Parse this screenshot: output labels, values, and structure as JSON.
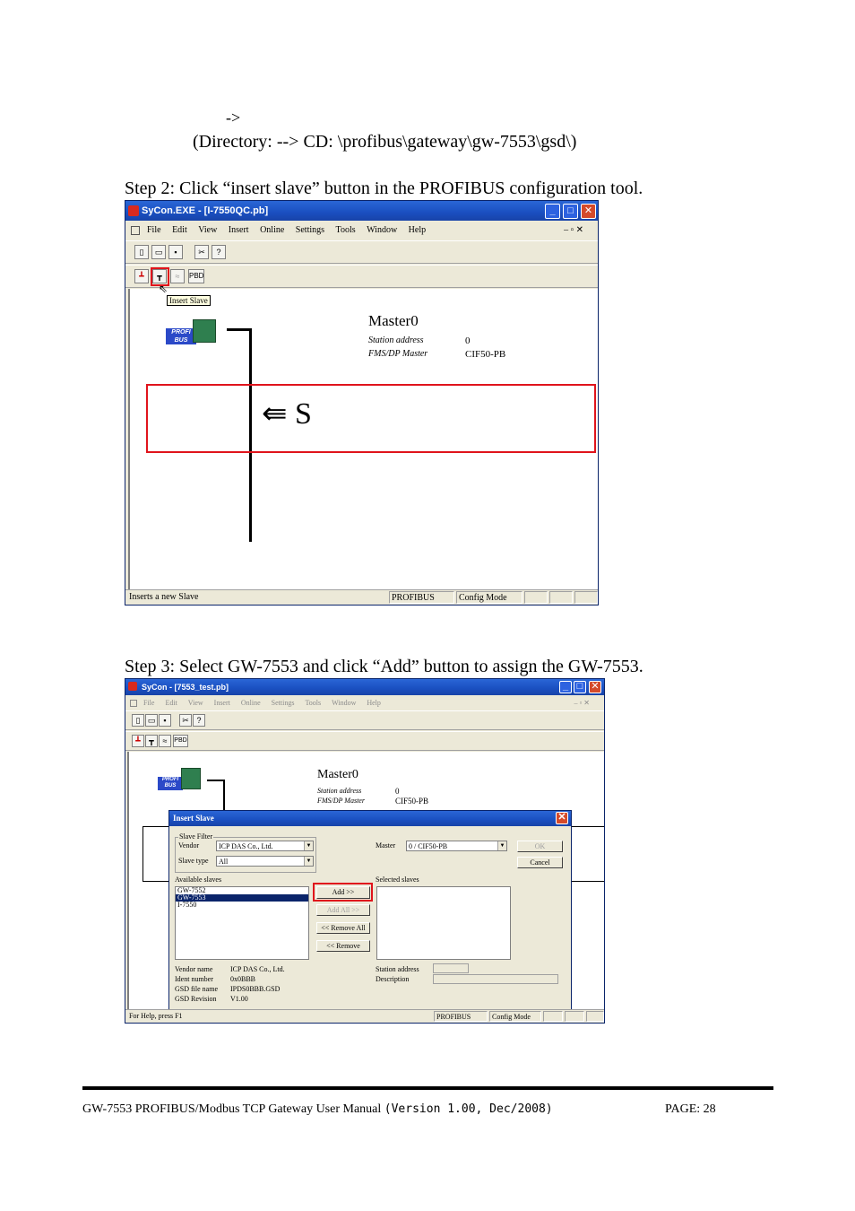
{
  "page": {
    "arrow_line": "->",
    "directory_line": "(Directory: --> CD: \\profibus\\gateway\\gw-7553\\gsd\\)",
    "step2": "Step 2:  Click “insert slave” button in the PROFIBUS configuration tool.",
    "step3": "Step 3:  Select GW-7553 and click “Add” button to assign the GW-7553.",
    "footer_manual": "GW-7553 PROFIBUS/Modbus TCP Gateway User Manual",
    "footer_version": "(Version 1.00, Dec/2008)",
    "footer_page": "PAGE: 28"
  },
  "screenshot1": {
    "title": "SyCon.EXE - [I-7550QC.pb]",
    "menu": [
      "File",
      "Edit",
      "View",
      "Insert",
      "Online",
      "Settings",
      "Tools",
      "Window",
      "Help"
    ],
    "pbd_label": "PBD",
    "tooltip": "Insert Slave",
    "master_name": "Master0",
    "station_label": "Station address",
    "station_value": "0",
    "type_label": "FMS/DP Master",
    "type_value": "CIF50-PB",
    "arrow_annotation": "⇚ S",
    "status_text": "Inserts a new Slave",
    "status_profibus": "PROFIBUS",
    "status_mode": "Config Mode"
  },
  "screenshot2": {
    "title": "SyCon - [7553_test.pb]",
    "menu": [
      "File",
      "Edit",
      "View",
      "Insert",
      "Online",
      "Settings",
      "Tools",
      "Window",
      "Help"
    ],
    "pbd_label": "PBD",
    "master_name": "Master0",
    "station_label": "Station address",
    "station_value": "0",
    "type_label": "FMS/DP Master",
    "type_value": "CIF50-PB",
    "dialog": {
      "title": "Insert Slave",
      "slave_filter_label": "Slave Filter",
      "vendor_label": "Vendor",
      "vendor_value": "ICP DAS Co., Ltd.",
      "slave_type_label": "Slave type",
      "slave_type_value": "All",
      "master_label": "Master",
      "master_value": "0 / CIF50-PB",
      "ok_label": "OK",
      "cancel_label": "Cancel",
      "available_label": "Available slaves",
      "available": [
        "GW-7552",
        "GW-7553",
        "I-7550"
      ],
      "selected_label": "Selected slaves",
      "add_label": "Add >>",
      "add_all_label": "Add All >>",
      "remove_all_label": "<< Remove All",
      "remove_label": "<< Remove",
      "vendor_name_label": "Vendor name",
      "vendor_name_value": "ICP DAS Co., Ltd.",
      "ident_label": "Ident number",
      "ident_value": "0x0BBB",
      "gsd_file_label": "GSD file name",
      "gsd_file_value": "IPDS0BBB.GSD",
      "gsd_rev_label": "GSD Revision",
      "gsd_rev_value": "V1.00",
      "station_addr_label": "Station address",
      "description_label": "Description"
    },
    "status_text": "For Help, press F1",
    "status_profibus": "PROFIBUS",
    "status_mode": "Config Mode"
  },
  "colors": {
    "highlight_red": "#e0141c",
    "title_blue": "#1a4fc0",
    "selection_blue": "#0a246a"
  }
}
